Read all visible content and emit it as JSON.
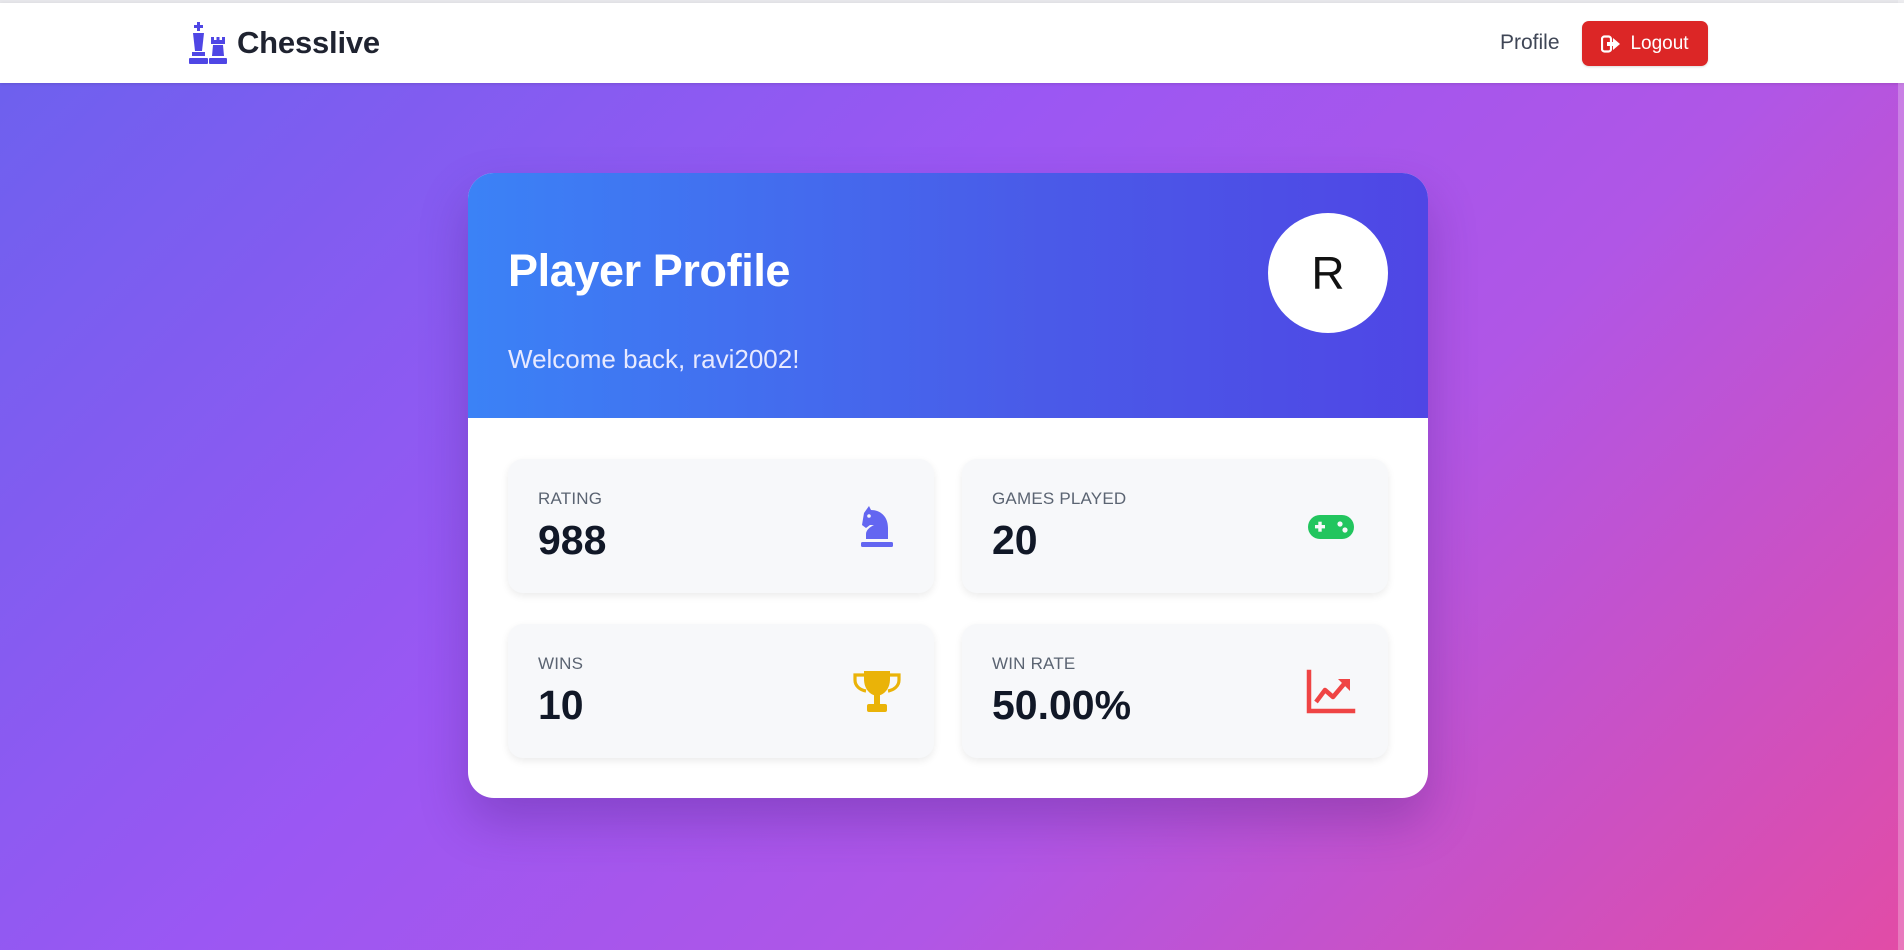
{
  "nav": {
    "brand": "Chesslive",
    "profile_link": "Profile",
    "logout_label": "Logout"
  },
  "profile": {
    "title": "Player Profile",
    "welcome": "Welcome back, ravi2002!",
    "avatar_initial": "R"
  },
  "stats": [
    {
      "label": "RATING",
      "value": "988",
      "icon": "chess-knight-icon",
      "color": "#6366f1"
    },
    {
      "label": "GAMES PLAYED",
      "value": "20",
      "icon": "gamepad-icon",
      "color": "#22c55e"
    },
    {
      "label": "WINS",
      "value": "10",
      "icon": "trophy-icon",
      "color": "#eab308"
    },
    {
      "label": "WIN RATE",
      "value": "50.00%",
      "icon": "chart-line-icon",
      "color": "#ef4444"
    }
  ],
  "colors": {
    "brand_icon": "#4f46e5",
    "logout": "#dc2626",
    "header_start": "#3b82f6",
    "header_end": "#4f46e5"
  }
}
